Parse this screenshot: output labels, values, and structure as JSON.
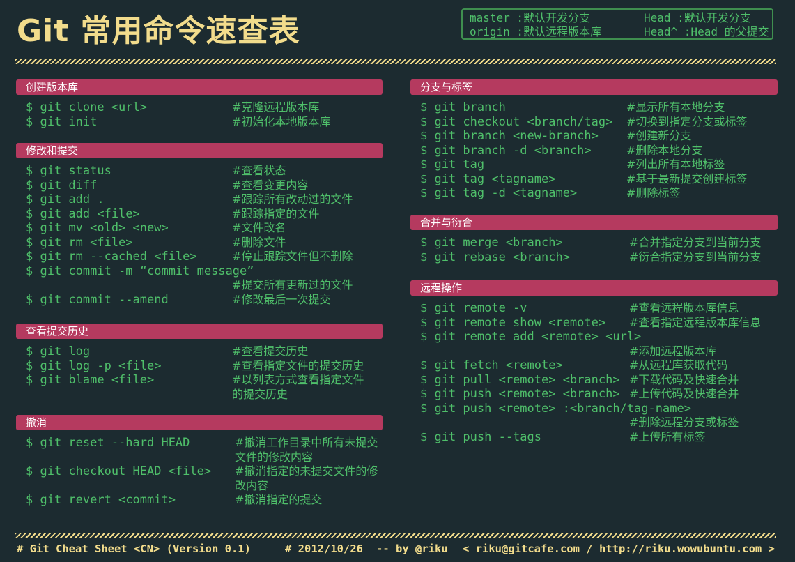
{
  "title": "Git 常用命令速查表",
  "legend": [
    [
      "master :默认开发分支",
      "Head :默认开发分支"
    ],
    [
      "origin :默认远程版本库",
      "Head^ :Head 的父提交"
    ]
  ],
  "sections": [
    {
      "title": "创建版本库",
      "rows": [
        [
          "$ git clone <url>",
          "#克隆远程版本库"
        ],
        [
          "$ git init",
          "#初始化本地版本库"
        ]
      ]
    },
    {
      "title": "修改和提交",
      "rows": [
        [
          "$ git status",
          "#查看状态"
        ],
        [
          "$ git diff",
          "#查看变更内容"
        ],
        [
          "$ git add .",
          "#跟踪所有改动过的文件"
        ],
        [
          "$ git add <file>",
          "#跟踪指定的文件"
        ],
        [
          "$ git mv <old> <new>",
          "#文件改名"
        ],
        [
          "$ git rm <file>",
          "#删除文件"
        ],
        [
          "$ git rm --cached <file>",
          "#停止跟踪文件但不删除"
        ],
        [
          "$ git commit -m “commit message”",
          ""
        ],
        [
          "",
          "#提交所有更新过的文件"
        ],
        [
          "$ git commit --amend",
          "#修改最后一次提交"
        ]
      ]
    },
    {
      "title": "查看提交历史",
      "rows": [
        [
          "$ git log",
          "#查看提交历史"
        ],
        [
          "$ git log -p <file>",
          "#查看指定文件的提交历史"
        ],
        [
          "$ git blame <file>",
          "#以列表方式查看指定文件"
        ],
        [
          "",
          "的提交历史"
        ]
      ]
    },
    {
      "title": "撤消",
      "rows": [
        [
          "$ git reset --hard HEAD",
          "#撤消工作目录中所有未提交"
        ],
        [
          "",
          "文件的修改内容"
        ],
        [
          "$ git checkout HEAD <file>",
          "#撤消指定的未提交文件的修"
        ],
        [
          "",
          "改内容"
        ],
        [
          "$ git revert <commit>",
          "#撤消指定的提交"
        ]
      ]
    },
    {
      "title": "分支与标签",
      "rows": [
        [
          "$ git branch",
          "#显示所有本地分支"
        ],
        [
          "$ git checkout <branch/tag>",
          "#切换到指定分支或标签"
        ],
        [
          "$ git branch <new-branch>",
          "#创建新分支"
        ],
        [
          "$ git branch -d <branch>",
          "#删除本地分支"
        ],
        [
          "$ git tag",
          "#列出所有本地标签"
        ],
        [
          "$ git tag <tagname>",
          "#基于最新提交创建标签"
        ],
        [
          "$ git tag -d <tagname>",
          "#删除标签"
        ]
      ]
    },
    {
      "title": "合并与衍合",
      "rows": [
        [
          "$ git merge <branch>",
          "#合并指定分支到当前分支"
        ],
        [
          "$ git rebase <branch>",
          "#衍合指定分支到当前分支"
        ]
      ]
    },
    {
      "title": "远程操作",
      "rows": [
        [
          "$ git remote -v",
          "#查看远程版本库信息"
        ],
        [
          "$ git remote show <remote>",
          "#查看指定远程版本库信息"
        ],
        [
          "$ git remote add <remote> <url>",
          ""
        ],
        [
          "",
          "#添加远程版本库"
        ],
        [
          "$ git fetch <remote>",
          "#从远程库获取代码"
        ],
        [
          "$ git pull <remote> <branch>",
          "#下载代码及快速合并"
        ],
        [
          "$ git push <remote> <branch>",
          "#上传代码及快速合并"
        ],
        [
          "$ git push <remote> :<branch/tag-name>",
          ""
        ],
        [
          "",
          "#删除远程分支或标签"
        ],
        [
          "$ git push --tags",
          "#上传所有标签"
        ]
      ]
    }
  ],
  "footer": {
    "left": "# Git Cheat Sheet <CN> (Version 0.1)",
    "date": "# 2012/10/26",
    "author": "-- by @riku",
    "contact": "< riku@gitcafe.com / http://riku.wowubuntu.com >"
  }
}
